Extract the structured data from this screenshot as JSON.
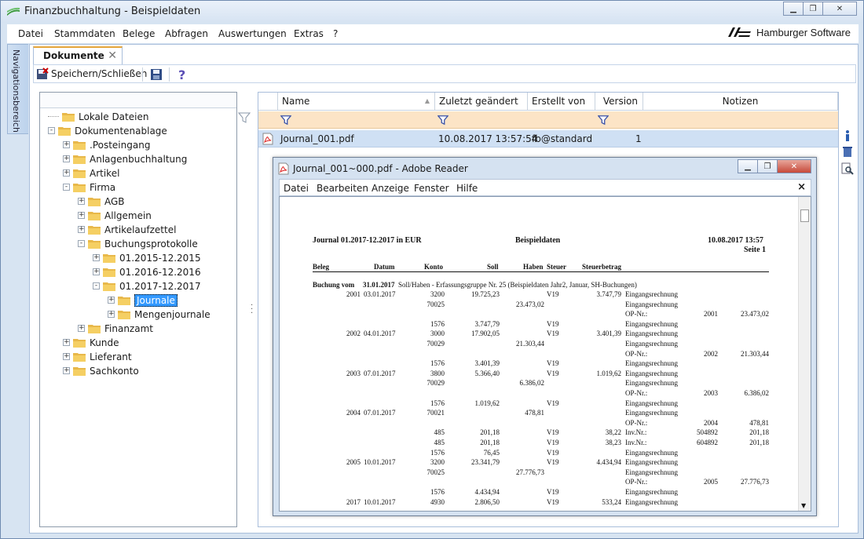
{
  "window": {
    "title": "Finanzbuchhaltung - Beispieldaten"
  },
  "menu": [
    "Datei",
    "Stammdaten",
    "Belege",
    "Abfragen",
    "Auswertungen",
    "Extras",
    "?"
  ],
  "brand": "Hamburger Software",
  "nav_tab": "Navigationsbereich",
  "doc_tab": {
    "label": "Dokumente"
  },
  "toolbar": {
    "save_close": "Speichern/Schließen"
  },
  "tree": [
    {
      "label": "Lokale Dateien",
      "level": 0,
      "exp": ""
    },
    {
      "label": "Dokumentenablage",
      "level": 0,
      "exp": "-"
    },
    {
      "label": ".Posteingang",
      "level": 1,
      "exp": "+"
    },
    {
      "label": "Anlagenbuchhaltung",
      "level": 1,
      "exp": "+"
    },
    {
      "label": "Artikel",
      "level": 1,
      "exp": "+"
    },
    {
      "label": "Firma",
      "level": 1,
      "exp": "-"
    },
    {
      "label": "AGB",
      "level": 2,
      "exp": "+"
    },
    {
      "label": "Allgemein",
      "level": 2,
      "exp": "+"
    },
    {
      "label": "Artikelaufzettel",
      "level": 2,
      "exp": "+"
    },
    {
      "label": "Buchungsprotokolle",
      "level": 2,
      "exp": "-"
    },
    {
      "label": "01.2015-12.2015",
      "level": 3,
      "exp": "+"
    },
    {
      "label": "01.2016-12.2016",
      "level": 3,
      "exp": "+"
    },
    {
      "label": "01.2017-12.2017",
      "level": 3,
      "exp": "-"
    },
    {
      "label": "Journale",
      "level": 4,
      "exp": "+",
      "selected": true
    },
    {
      "label": "Mengenjournale",
      "level": 4,
      "exp": "+"
    },
    {
      "label": "Finanzamt",
      "level": 2,
      "exp": "+"
    },
    {
      "label": "Kunde",
      "level": 1,
      "exp": "+"
    },
    {
      "label": "Lieferant",
      "level": 1,
      "exp": "+"
    },
    {
      "label": "Sachkonto",
      "level": 1,
      "exp": "+"
    }
  ],
  "grid": {
    "columns": {
      "name": "Name",
      "modified": "Zuletzt geändert",
      "created_by": "Erstellt von",
      "version": "Version",
      "notes": "Notizen"
    },
    "row": {
      "name": "Journal_001.pdf",
      "modified": "10.08.2017 13:57:54",
      "created_by": "fb@standard",
      "version": "1"
    }
  },
  "reader": {
    "title": "Journal_001~000.pdf - Adobe Reader",
    "menu": [
      "Datei",
      "Bearbeiten",
      "Anzeige",
      "Fenster",
      "Hilfe"
    ],
    "close": "×"
  },
  "pdf": {
    "heading": "Journal 01.2017-12.2017 in EUR",
    "company": "Beispieldaten",
    "date": "10.08.2017 13:57",
    "page": "Seite 1",
    "cols": [
      "Beleg",
      "Datum",
      "Konto",
      "Soll",
      "Haben",
      "Steuer",
      "Steuerbetrag"
    ],
    "booking_label": "Buchung vom",
    "booking_date": "31.01.2017",
    "booking_desc": "Soll/Haben - Erfassungsgruppe Nr. 25 (Beispieldaten Jahr2, Januar, SH-Buchungen)",
    "lines": [
      {
        "beleg": "2001",
        "datum": "03.01.2017",
        "konto": "3200",
        "soll": "19.725,23",
        "haben": "",
        "steuer": "V19",
        "betrag": "3.747,79",
        "text": "Eingangsrechnung",
        "op": "",
        "opn": "",
        "opb": ""
      },
      {
        "beleg": "",
        "datum": "",
        "konto": "70025",
        "soll": "",
        "haben": "23.473,02",
        "steuer": "",
        "betrag": "",
        "text": "Eingangsrechnung",
        "op": "",
        "opn": "",
        "opb": ""
      },
      {
        "beleg": "",
        "datum": "",
        "konto": "",
        "soll": "",
        "haben": "",
        "steuer": "",
        "betrag": "",
        "text": "",
        "op": "OP-Nr.:",
        "opn": "2001",
        "opb": "23.473,02"
      },
      {
        "beleg": "",
        "datum": "",
        "konto": "1576",
        "soll": "3.747,79",
        "haben": "",
        "steuer": "V19",
        "betrag": "",
        "text": "Eingangsrechnung",
        "op": "",
        "opn": "",
        "opb": ""
      },
      {
        "beleg": "2002",
        "datum": "04.01.2017",
        "konto": "3000",
        "soll": "17.902,05",
        "haben": "",
        "steuer": "V19",
        "betrag": "3.401,39",
        "text": "Eingangsrechnung",
        "op": "",
        "opn": "",
        "opb": ""
      },
      {
        "beleg": "",
        "datum": "",
        "konto": "70029",
        "soll": "",
        "haben": "21.303,44",
        "steuer": "",
        "betrag": "",
        "text": "Eingangsrechnung",
        "op": "",
        "opn": "",
        "opb": ""
      },
      {
        "beleg": "",
        "datum": "",
        "konto": "",
        "soll": "",
        "haben": "",
        "steuer": "",
        "betrag": "",
        "text": "",
        "op": "OP-Nr.:",
        "opn": "2002",
        "opb": "21.303,44"
      },
      {
        "beleg": "",
        "datum": "",
        "konto": "1576",
        "soll": "3.401,39",
        "haben": "",
        "steuer": "V19",
        "betrag": "",
        "text": "Eingangsrechnung",
        "op": "",
        "opn": "",
        "opb": ""
      },
      {
        "beleg": "2003",
        "datum": "07.01.2017",
        "konto": "3800",
        "soll": "5.366,40",
        "haben": "",
        "steuer": "V19",
        "betrag": "1.019,62",
        "text": "Eingangsrechnung",
        "op": "",
        "opn": "",
        "opb": ""
      },
      {
        "beleg": "",
        "datum": "",
        "konto": "70029",
        "soll": "",
        "haben": "6.386,02",
        "steuer": "",
        "betrag": "",
        "text": "Eingangsrechnung",
        "op": "",
        "opn": "",
        "opb": ""
      },
      {
        "beleg": "",
        "datum": "",
        "konto": "",
        "soll": "",
        "haben": "",
        "steuer": "",
        "betrag": "",
        "text": "",
        "op": "OP-Nr.:",
        "opn": "2003",
        "opb": "6.386,02"
      },
      {
        "beleg": "",
        "datum": "",
        "konto": "1576",
        "soll": "1.019,62",
        "haben": "",
        "steuer": "V19",
        "betrag": "",
        "text": "Eingangsrechnung",
        "op": "",
        "opn": "",
        "opb": ""
      },
      {
        "beleg": "2004",
        "datum": "07.01.2017",
        "konto": "70021",
        "soll": "",
        "haben": "478,81",
        "steuer": "",
        "betrag": "",
        "text": "Eingangsrechnung",
        "op": "",
        "opn": "",
        "opb": ""
      },
      {
        "beleg": "",
        "datum": "",
        "konto": "",
        "soll": "",
        "haben": "",
        "steuer": "",
        "betrag": "",
        "text": "",
        "op": "OP-Nr.:",
        "opn": "2004",
        "opb": "478,81"
      },
      {
        "beleg": "",
        "datum": "",
        "konto": "485",
        "soll": "201,18",
        "haben": "",
        "steuer": "V19",
        "betrag": "38,22",
        "text": "",
        "op": "Inv.Nr.:",
        "opn": "504892",
        "opb": "201,18"
      },
      {
        "beleg": "",
        "datum": "",
        "konto": "485",
        "soll": "201,18",
        "haben": "",
        "steuer": "V19",
        "betrag": "38,23",
        "text": "",
        "op": "Inv.Nr.:",
        "opn": "604892",
        "opb": "201,18"
      },
      {
        "beleg": "",
        "datum": "",
        "konto": "1576",
        "soll": "76,45",
        "haben": "",
        "steuer": "V19",
        "betrag": "",
        "text": "Eingangsrechnung",
        "op": "",
        "opn": "",
        "opb": ""
      },
      {
        "beleg": "2005",
        "datum": "10.01.2017",
        "konto": "3200",
        "soll": "23.341,79",
        "haben": "",
        "steuer": "V19",
        "betrag": "4.434,94",
        "text": "Eingangsrechnung",
        "op": "",
        "opn": "",
        "opb": ""
      },
      {
        "beleg": "",
        "datum": "",
        "konto": "70025",
        "soll": "",
        "haben": "27.776,73",
        "steuer": "",
        "betrag": "",
        "text": "Eingangsrechnung",
        "op": "",
        "opn": "",
        "opb": ""
      },
      {
        "beleg": "",
        "datum": "",
        "konto": "",
        "soll": "",
        "haben": "",
        "steuer": "",
        "betrag": "",
        "text": "",
        "op": "OP-Nr.:",
        "opn": "2005",
        "opb": "27.776,73"
      },
      {
        "beleg": "",
        "datum": "",
        "konto": "1576",
        "soll": "4.434,94",
        "haben": "",
        "steuer": "V19",
        "betrag": "",
        "text": "Eingangsrechnung",
        "op": "",
        "opn": "",
        "opb": ""
      },
      {
        "beleg": "2017",
        "datum": "10.01.2017",
        "konto": "4930",
        "soll": "2.806,50",
        "haben": "",
        "steuer": "V19",
        "betrag": "533,24",
        "text": "Eingangsrechnung",
        "op": "",
        "opn": "",
        "opb": ""
      }
    ]
  }
}
